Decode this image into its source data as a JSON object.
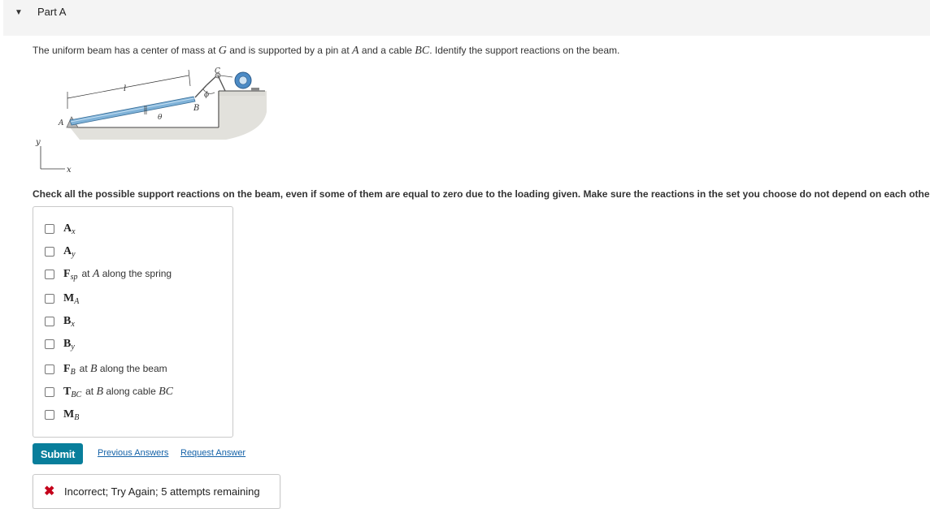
{
  "header": {
    "caret_icon": "triangle-down-icon",
    "title": "Part A"
  },
  "question": {
    "pre": "The uniform beam has a center of mass at ",
    "G": "G",
    "mid1": " and is supported by a pin at ",
    "A": "A",
    "mid2": " and a cable ",
    "BC": "BC",
    "post": ". Identify the support reactions on the beam."
  },
  "figure": {
    "label_C": "C",
    "label_l": "l",
    "label_phi": "ϕ",
    "label_B": "B",
    "label_A": "A",
    "label_theta": "θ",
    "label_y": "y",
    "label_x": "x"
  },
  "instruction": "Check all the possible support reactions on the beam, even if some of them are equal to zero due to the loading given. Make sure the reactions in the set you choose do not depend on each other.",
  "options": [
    {
      "sym": "A",
      "sub": "x",
      "desc_pre": "",
      "desc_var": "",
      "desc_post": "",
      "checked": false
    },
    {
      "sym": "A",
      "sub": "y",
      "desc_pre": "",
      "desc_var": "",
      "desc_post": "",
      "checked": false
    },
    {
      "sym": "F",
      "sub": "sp",
      "desc_pre": "at ",
      "desc_var": "A",
      "desc_post": " along the spring",
      "checked": false
    },
    {
      "sym": "M",
      "sub": "A",
      "desc_pre": "",
      "desc_var": "",
      "desc_post": "",
      "checked": false
    },
    {
      "sym": "B",
      "sub": "x",
      "desc_pre": "",
      "desc_var": "",
      "desc_post": "",
      "checked": false
    },
    {
      "sym": "B",
      "sub": "y",
      "desc_pre": "",
      "desc_var": "",
      "desc_post": "",
      "checked": false
    },
    {
      "sym": "F",
      "sub": "B",
      "desc_pre": "at ",
      "desc_var": "B",
      "desc_post": " along the beam",
      "checked": false
    },
    {
      "sym": "T",
      "sub": "BC",
      "desc_pre": "at ",
      "desc_var": "B",
      "desc_post": " along cable ",
      "desc_var2": "BC",
      "checked": false
    },
    {
      "sym": "M",
      "sub": "B",
      "desc_pre": "",
      "desc_var": "",
      "desc_post": "",
      "checked": false
    }
  ],
  "actions": {
    "submit_label": "Submit",
    "previous_answers_label": "Previous Answers",
    "request_answer_label": "Request Answer"
  },
  "feedback": {
    "icon": "x-mark-icon",
    "text": "Incorrect; Try Again; 5 attempts remaining"
  },
  "colors": {
    "submit_bg": "#087e9b",
    "link": "#1462a8",
    "error": "#c4001a",
    "beam": "#7fb2d8"
  }
}
